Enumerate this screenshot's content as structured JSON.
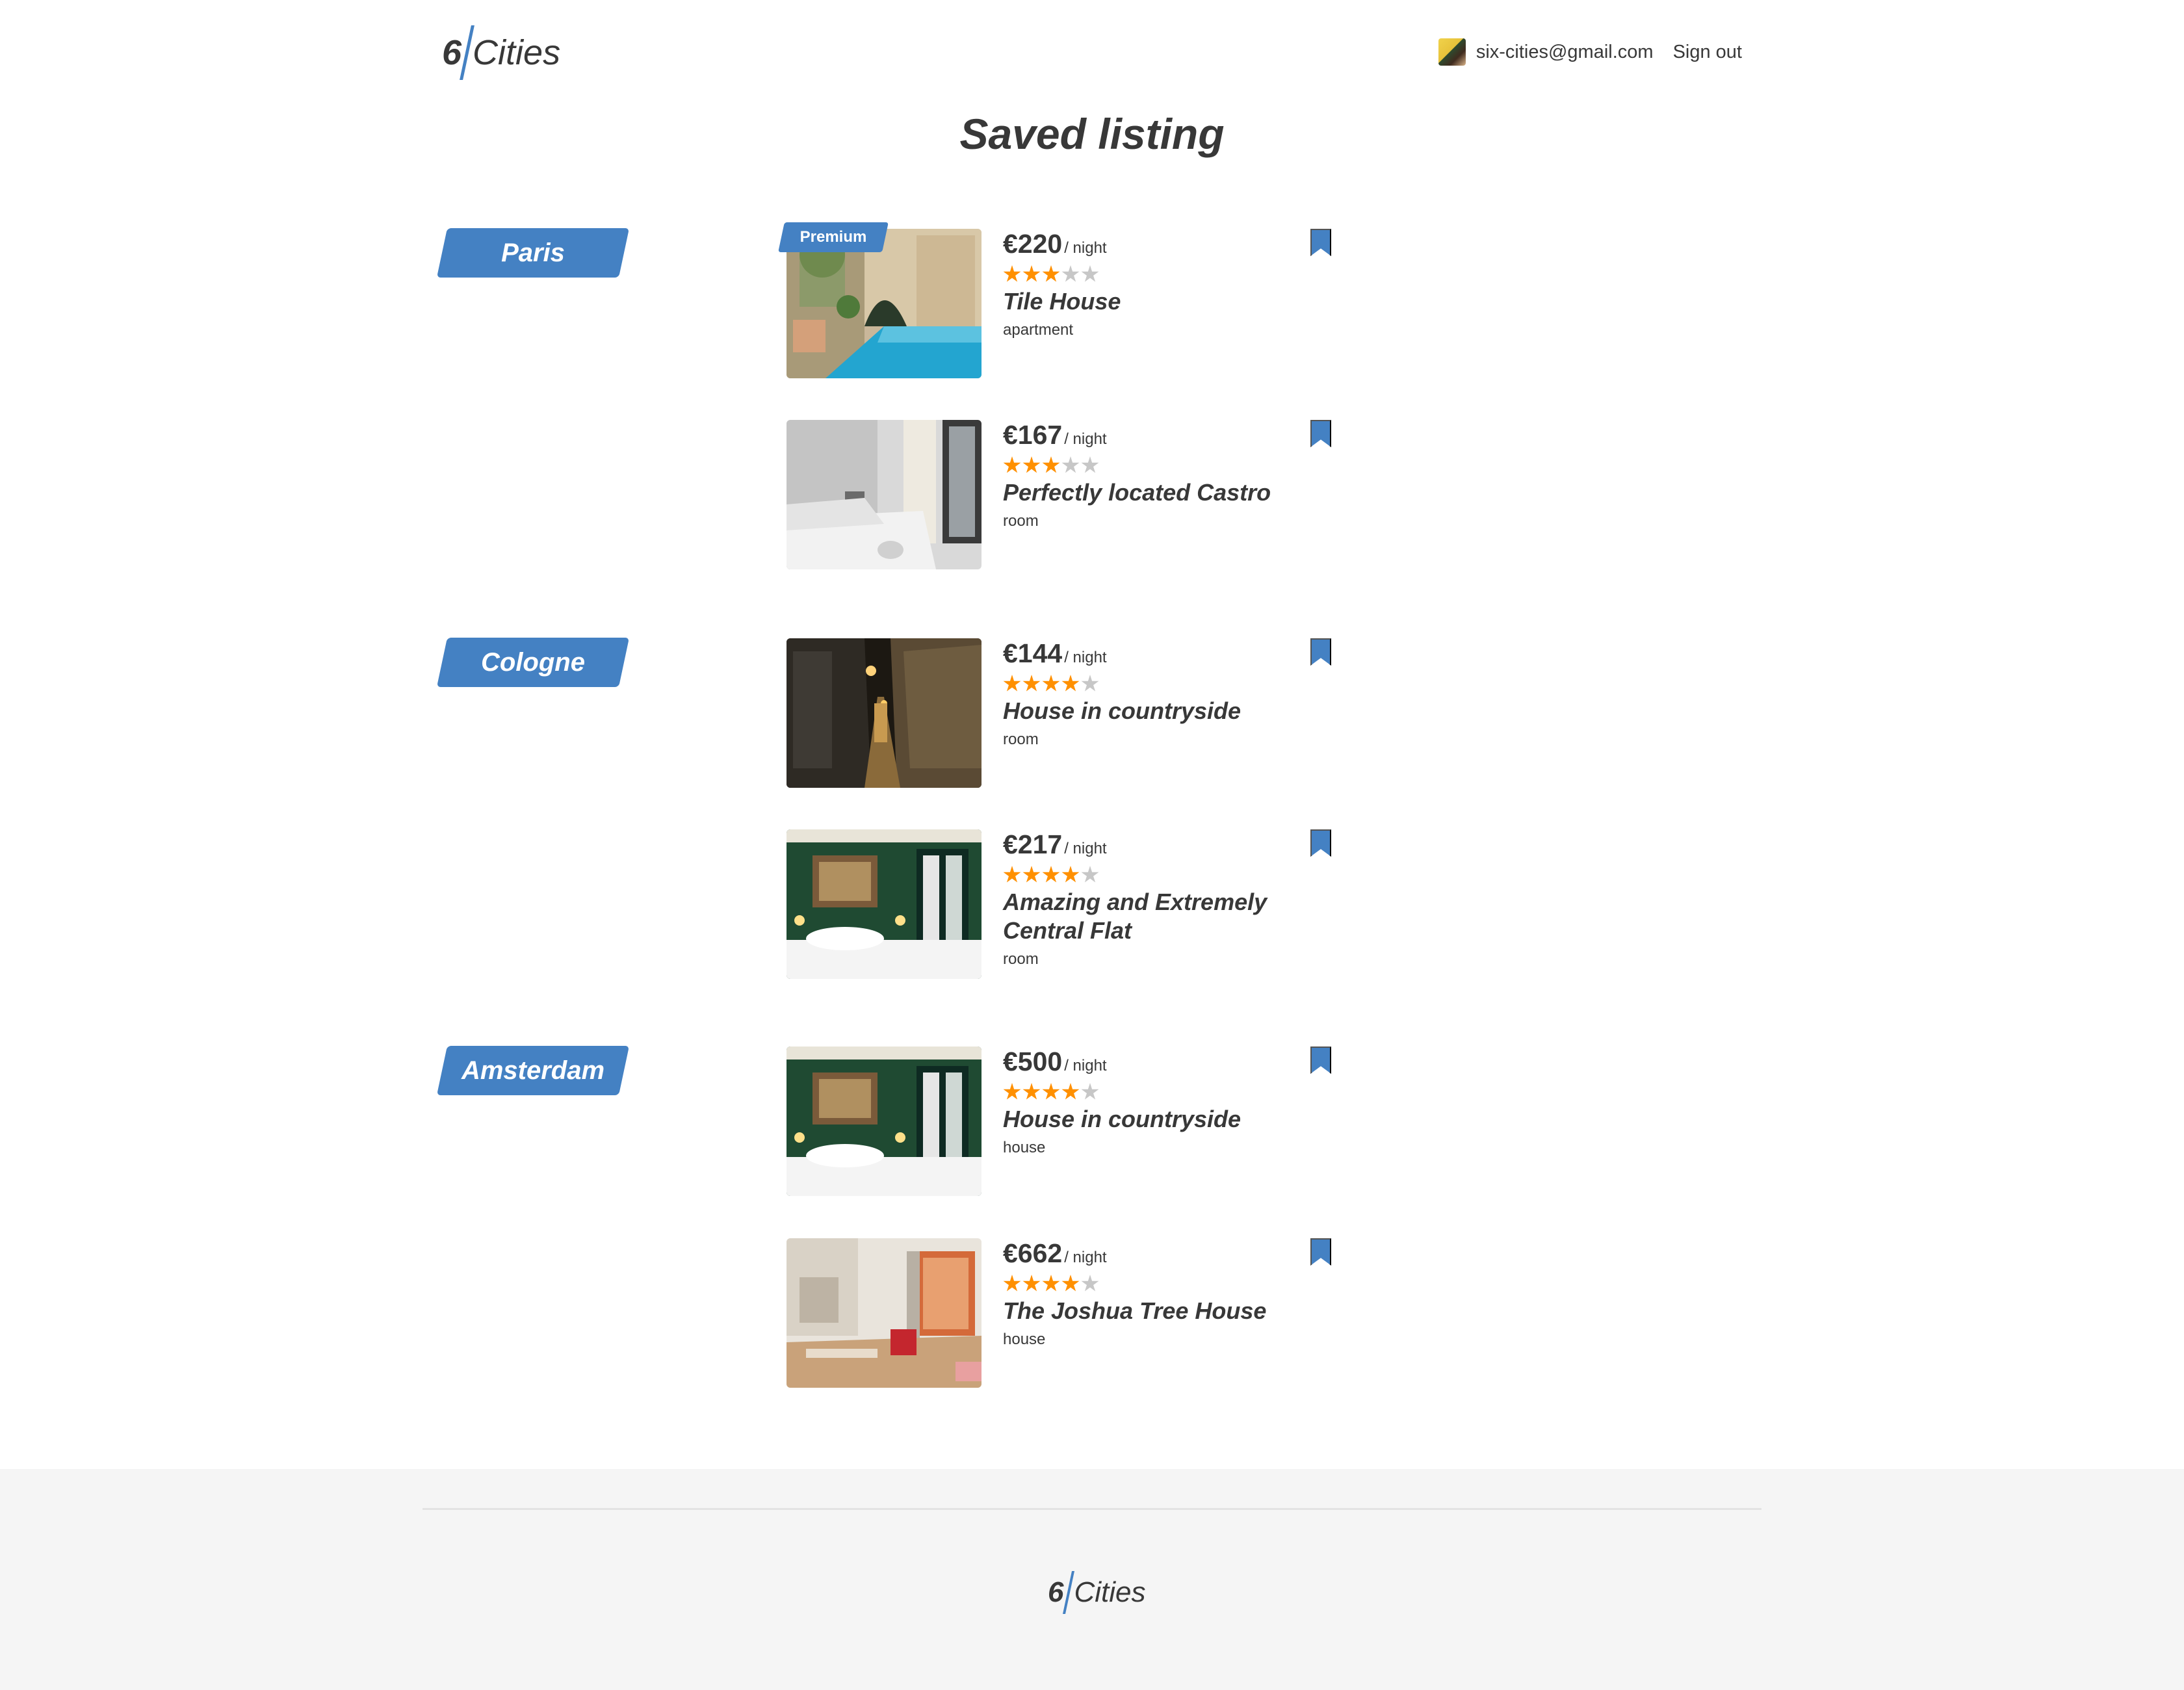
{
  "header": {
    "logo_number": "6",
    "logo_text": "Cities",
    "user_email": "six-cities@gmail.com",
    "sign_out_label": "Sign out"
  },
  "page_title": "Saved listing",
  "cities": [
    {
      "name": "Paris"
    },
    {
      "name": "Cologne"
    },
    {
      "name": "Amsterdam"
    }
  ],
  "offers": [
    {
      "city": "Paris",
      "premium": true,
      "premium_label": "Premium",
      "price": "€220",
      "per_night": "/ night",
      "rating_stars": 3,
      "title": "Tile House",
      "type": "apartment",
      "image": "pool-courtyard"
    },
    {
      "city": "Paris",
      "premium": false,
      "price": "€167",
      "per_night": "/ night",
      "rating_stars": 3,
      "title": "Perfectly located Castro",
      "type": "room",
      "image": "white-bedroom"
    },
    {
      "city": "Cologne",
      "premium": false,
      "price": "€144",
      "per_night": "/ night",
      "rating_stars": 4,
      "title": "House in countryside",
      "type": "room",
      "image": "night-alley"
    },
    {
      "city": "Cologne",
      "premium": false,
      "price": "€217",
      "per_night": "/ night",
      "rating_stars": 4,
      "title": "Amazing and Extremely Central Flat",
      "type": "room",
      "image": "green-bedroom"
    },
    {
      "city": "Amsterdam",
      "premium": false,
      "price": "€500",
      "per_night": "/ night",
      "rating_stars": 4,
      "title": "House in countryside",
      "type": "house",
      "image": "green-bedroom"
    },
    {
      "city": "Amsterdam",
      "premium": false,
      "price": "€662",
      "per_night": "/ night",
      "rating_stars": 4,
      "title": "The Joshua Tree House",
      "type": "house",
      "image": "living-room"
    }
  ],
  "colors": {
    "accent": "#4481c3",
    "star_on": "#ff9000",
    "star_off": "#c7c7c7",
    "text": "#383838",
    "footer_bg": "#f5f5f5"
  },
  "icons": {
    "bookmark": "bookmark-icon",
    "star": "star-icon",
    "avatar": "user-avatar"
  },
  "footer": {
    "logo_number": "6",
    "logo_text": "Cities"
  }
}
